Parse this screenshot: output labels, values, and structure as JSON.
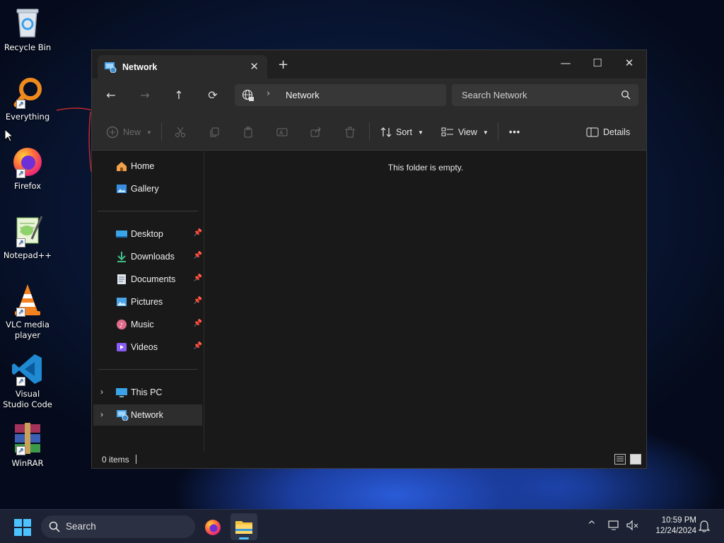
{
  "desktop": {
    "icons": [
      {
        "label": "Recycle Bin",
        "shortcut": false
      },
      {
        "label": "Everything",
        "shortcut": true
      },
      {
        "label": "Firefox",
        "shortcut": true
      },
      {
        "label": "Notepad++",
        "shortcut": true
      },
      {
        "label": "VLC media player",
        "shortcut": true
      },
      {
        "label": "Visual Studio Code",
        "shortcut": true
      },
      {
        "label": "WinRAR",
        "shortcut": true
      }
    ]
  },
  "window": {
    "tab": {
      "title": "Network",
      "close_glyph": "✕"
    },
    "new_tab_glyph": "+",
    "controls": {
      "minimize": "—",
      "maximize": "☐",
      "close": "✕"
    },
    "address": {
      "crumb": "Network"
    },
    "search": {
      "placeholder": "Search Network"
    },
    "commands": {
      "new": "New",
      "sort": "Sort",
      "view": "View",
      "more": "•••",
      "details": "Details"
    },
    "sidebar": {
      "top": [
        {
          "label": "Home"
        },
        {
          "label": "Gallery"
        }
      ],
      "pinned": [
        {
          "label": "Desktop"
        },
        {
          "label": "Downloads"
        },
        {
          "label": "Documents"
        },
        {
          "label": "Pictures"
        },
        {
          "label": "Music"
        },
        {
          "label": "Videos"
        }
      ],
      "tree": [
        {
          "label": "This PC",
          "selected": false
        },
        {
          "label": "Network",
          "selected": true
        }
      ]
    },
    "content": {
      "empty_message": "This folder is empty."
    },
    "status": {
      "items": "0 items"
    }
  },
  "taskbar": {
    "search_label": "Search",
    "time": "10:59 PM",
    "date": "12/24/2024"
  },
  "colors": {
    "accent": "#4cc2ff",
    "window_bg": "#191919",
    "toolbar_bg": "#2b2b2b"
  }
}
